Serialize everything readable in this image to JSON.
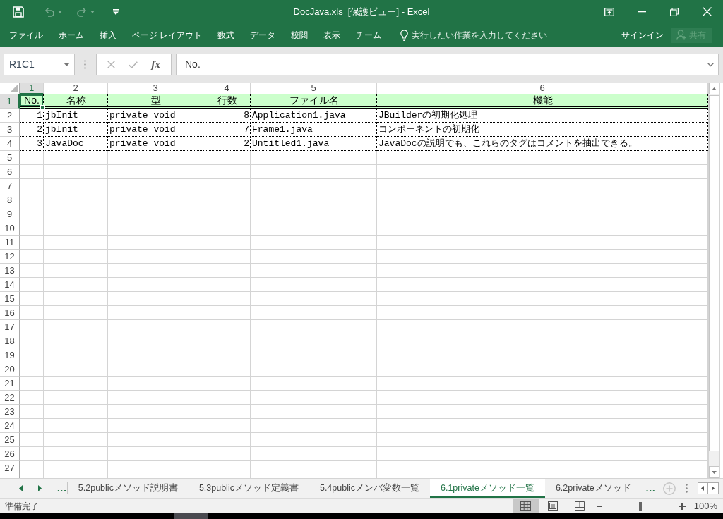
{
  "title_bar": {
    "title": "DocJava.xls  [保護ビュー] - Excel",
    "quick_access": [
      {
        "kind": "save",
        "disabled": false
      },
      {
        "kind": "undo",
        "disabled": true
      },
      {
        "kind": "redo",
        "disabled": true
      },
      {
        "kind": "customize",
        "disabled": false
      }
    ]
  },
  "ribbon": {
    "tabs": [
      "ファイル",
      "ホーム",
      "挿入",
      "ページ レイアウト",
      "数式",
      "データ",
      "校閲",
      "表示",
      "チーム"
    ],
    "tell_me": {
      "placeholder": "実行したい作業を入力してください"
    },
    "sign_in": "サインイン",
    "share": {
      "label": "共有",
      "disabled": true
    }
  },
  "formula_bar": {
    "name_box": "R1C1",
    "buttons": [
      {
        "kind": "cancel",
        "disabled": true
      },
      {
        "kind": "enter",
        "disabled": true
      },
      {
        "kind": "function",
        "label": "fx",
        "disabled": false
      }
    ],
    "formula": "No."
  },
  "sheet": {
    "columns": [
      {
        "label": "1",
        "kind": "number",
        "selected": true
      },
      {
        "label": "2",
        "kind": "text",
        "selected": false
      },
      {
        "label": "3",
        "kind": "text",
        "selected": false
      },
      {
        "label": "4",
        "kind": "number",
        "selected": false
      },
      {
        "label": "5",
        "kind": "text",
        "selected": false
      },
      {
        "label": "6",
        "kind": "text",
        "selected": false
      }
    ],
    "rows": [
      {
        "label": "1",
        "kind": "header",
        "selected": true,
        "cells": [
          "No.",
          "名称",
          "型",
          "行数",
          "ファイル名",
          "機能"
        ]
      },
      {
        "label": "2",
        "kind": "data",
        "selected": false,
        "cells": [
          "1",
          "jbInit",
          "private void",
          "8",
          "Application1.java",
          "JBuilderの初期化処理"
        ]
      },
      {
        "label": "3",
        "kind": "data",
        "selected": false,
        "cells": [
          "2",
          "jbInit",
          "private void",
          "7",
          "Frame1.java",
          "コンポーネントの初期化"
        ]
      },
      {
        "label": "4",
        "kind": "data",
        "selected": false,
        "cells": [
          "3",
          "JavaDoc",
          "private void",
          "2",
          "Untitled1.java",
          "JavaDocの説明でも、これらのタグはコメントを抽出できる。"
        ]
      },
      {
        "label": "5",
        "kind": "empty",
        "selected": false
      },
      {
        "label": "6",
        "kind": "empty",
        "selected": false
      },
      {
        "label": "7",
        "kind": "empty",
        "selected": false
      },
      {
        "label": "8",
        "kind": "empty",
        "selected": false
      },
      {
        "label": "9",
        "kind": "empty",
        "selected": false
      },
      {
        "label": "10",
        "kind": "empty",
        "selected": false
      },
      {
        "label": "11",
        "kind": "empty",
        "selected": false
      },
      {
        "label": "12",
        "kind": "empty",
        "selected": false
      },
      {
        "label": "13",
        "kind": "empty",
        "selected": false
      },
      {
        "label": "14",
        "kind": "empty",
        "selected": false
      },
      {
        "label": "15",
        "kind": "empty",
        "selected": false
      },
      {
        "label": "16",
        "kind": "empty",
        "selected": false
      },
      {
        "label": "17",
        "kind": "empty",
        "selected": false
      },
      {
        "label": "18",
        "kind": "empty",
        "selected": false
      },
      {
        "label": "19",
        "kind": "empty",
        "selected": false
      },
      {
        "label": "20",
        "kind": "empty",
        "selected": false
      },
      {
        "label": "21",
        "kind": "empty",
        "selected": false
      },
      {
        "label": "22",
        "kind": "empty",
        "selected": false
      },
      {
        "label": "23",
        "kind": "empty",
        "selected": false
      },
      {
        "label": "24",
        "kind": "empty",
        "selected": false
      },
      {
        "label": "25",
        "kind": "empty",
        "selected": false
      },
      {
        "label": "26",
        "kind": "empty",
        "selected": false
      },
      {
        "label": "27",
        "kind": "empty",
        "selected": false
      }
    ]
  },
  "sheet_tabs": {
    "more_left": "...",
    "tabs": [
      {
        "label": "5.2publicメソッド説明書",
        "selected": false
      },
      {
        "label": "5.3publicメソッド定義書",
        "selected": false
      },
      {
        "label": "5.4publicメンバ変数一覧",
        "selected": false
      },
      {
        "label": "6.1privateメソッド一覧",
        "selected": true
      },
      {
        "label": "6.2privateメソッド",
        "selected": false
      }
    ],
    "more_right": "..."
  },
  "status_bar": {
    "status": "準備完了",
    "views": [
      {
        "kind": "normal",
        "selected": true
      },
      {
        "kind": "page_layout",
        "selected": false
      },
      {
        "kind": "page_break",
        "selected": false
      }
    ],
    "zoom": {
      "level": 0.5,
      "reading": "100%"
    }
  }
}
